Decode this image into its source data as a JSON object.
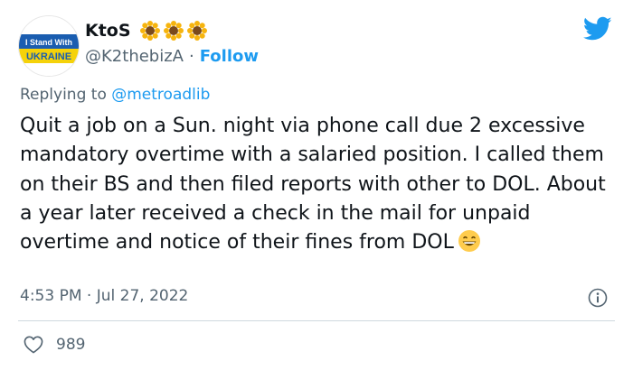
{
  "author": {
    "display_name": "KtoS",
    "handle": "@K2thebizA",
    "separator": "·",
    "follow_label": "Follow",
    "avatar_badge": {
      "line1": "I Stand With",
      "line2": "UKRAINE",
      "top_color": "#1a5db0",
      "bottom_color": "#f5d20a"
    },
    "name_emojis": [
      "sunflower-icon",
      "sunflower-icon",
      "sunflower-icon"
    ]
  },
  "reply": {
    "prefix": "Replying to",
    "mention": "@metroadlib"
  },
  "tweet": {
    "text": "Quit a job on a Sun. night via phone call due 2 excessive mandatory overtime with a salaried position. I called them on their BS and then filed reports with other to DOL. About a year later received a check in the mail for unpaid overtime and notice of their fines from DOL",
    "trailing_emoji": "grinning-face-icon"
  },
  "meta": {
    "timestamp": "4:53 PM · Jul 27, 2022",
    "likes": "989"
  },
  "colors": {
    "accent": "#1d9bf0",
    "muted_text": "#536471",
    "primary_text": "#0f1419",
    "divider": "#cfd9de"
  }
}
